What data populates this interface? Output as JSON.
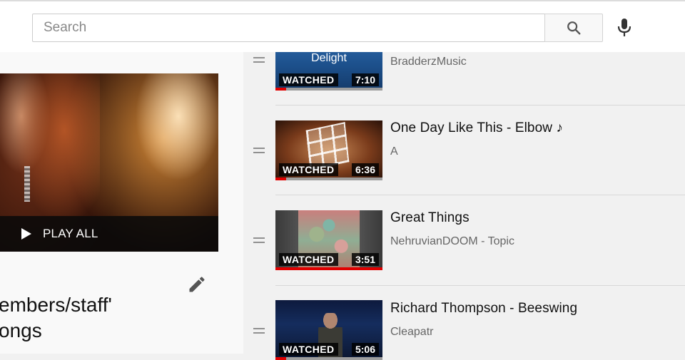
{
  "header": {
    "search_placeholder": "Search",
    "search_icon": "search-icon",
    "mic_icon": "microphone-icon"
  },
  "left_panel": {
    "play_all_label": "PLAY ALL",
    "edit_icon": "pencil-icon",
    "title_partial": "embers/staff'\nongs"
  },
  "playlist": {
    "items": [
      {
        "title": "",
        "thumb_text": "Delight",
        "channel": "BradderzMusic",
        "watched_label": "WATCHED",
        "duration": "7:10",
        "progress": 0.1
      },
      {
        "title": "One Day Like This - Elbow ♪",
        "channel": "A",
        "watched_label": "WATCHED",
        "duration": "6:36",
        "progress": 0.1
      },
      {
        "title": "Great Things",
        "channel": "NehruvianDOOM - Topic",
        "watched_label": "WATCHED",
        "duration": "3:51",
        "progress": 1.0
      },
      {
        "title": "Richard Thompson - Beeswing",
        "channel": "Cleapatr",
        "watched_label": "WATCHED",
        "duration": "5:06",
        "progress": 0.1
      }
    ]
  },
  "colors": {
    "progress_red": "#e00000",
    "panel_bg": "#f1f1f1",
    "header_bg": "#ffffff"
  }
}
